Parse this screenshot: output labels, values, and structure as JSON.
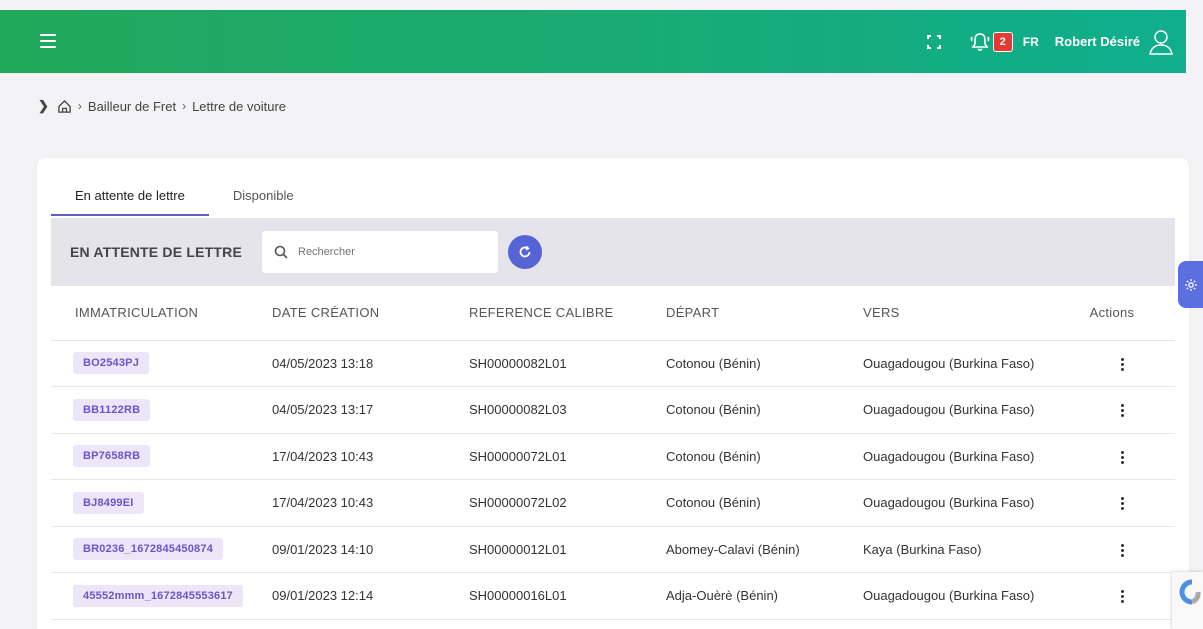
{
  "colors": {
    "header_start": "#22a85a",
    "header_end": "#0fae8d",
    "accent": "#5b5fc7",
    "badge": "#e53935",
    "chip_bg": "#ece6f8",
    "chip_text": "#6a56c9"
  },
  "header": {
    "menu_icon": "hamburger-icon",
    "fullscreen_icon": "fullscreen-icon",
    "bell_icon": "bell-icon",
    "notification_count": "2",
    "language": "FR",
    "user_name": "Robert Désiré",
    "user_icon": "user-icon"
  },
  "breadcrumb": {
    "items": [
      "Bailleur de Fret",
      "Lettre de voiture"
    ]
  },
  "tabs": [
    {
      "label": "En attente de lettre",
      "active": true
    },
    {
      "label": "Disponible",
      "active": false
    }
  ],
  "toolbar": {
    "title": "EN ATTENTE DE LETTRE",
    "search_placeholder": "Rechercher"
  },
  "table": {
    "columns": [
      "IMMATRICULATION",
      "DATE CRÉATION",
      "REFERENCE CALIBRE",
      "DÉPART",
      "VERS",
      "Actions"
    ],
    "rows": [
      {
        "imm": "BO2543PJ",
        "date": "04/05/2023 13:18",
        "ref": "SH00000082L01",
        "depart": "Cotonou (Bénin)",
        "vers": "Ouagadougou (Burkina Faso)"
      },
      {
        "imm": "BB1122RB",
        "date": "04/05/2023 13:17",
        "ref": "SH00000082L03",
        "depart": "Cotonou (Bénin)",
        "vers": "Ouagadougou (Burkina Faso)"
      },
      {
        "imm": "BP7658RB",
        "date": "17/04/2023 10:43",
        "ref": "SH00000072L01",
        "depart": "Cotonou (Bénin)",
        "vers": "Ouagadougou (Burkina Faso)"
      },
      {
        "imm": "BJ8499EI",
        "date": "17/04/2023 10:43",
        "ref": "SH00000072L02",
        "depart": "Cotonou (Bénin)",
        "vers": "Ouagadougou (Burkina Faso)"
      },
      {
        "imm": "BR0236_1672845450874",
        "date": "09/01/2023 14:10",
        "ref": "SH00000012L01",
        "depart": "Abomey-Calavi (Bénin)",
        "vers": "Kaya (Burkina Faso)"
      },
      {
        "imm": "45552mmm_1672845553617",
        "date": "09/01/2023 12:14",
        "ref": "SH00000016L01",
        "depart": "Adja-Ouèrè (Bénin)",
        "vers": "Ouagadougou (Burkina Faso)"
      }
    ]
  }
}
